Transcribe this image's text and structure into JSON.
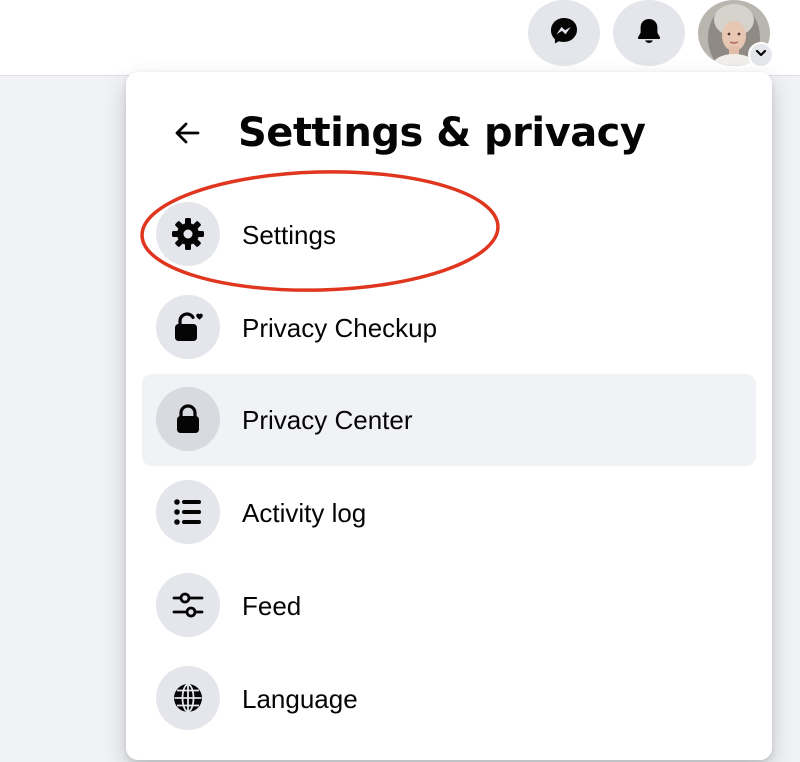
{
  "topbar": {
    "messenger_icon": "messenger-icon",
    "notifications_icon": "bell-icon",
    "account_chevron_icon": "chevron-down-icon"
  },
  "panel": {
    "title": "Settings & privacy",
    "back_icon": "arrow-left-icon",
    "items": [
      {
        "label": "Settings",
        "icon": "gear-icon",
        "highlighted": true
      },
      {
        "label": "Privacy Checkup",
        "icon": "lock-heart-icon"
      },
      {
        "label": "Privacy Center",
        "icon": "lock-icon",
        "active": true
      },
      {
        "label": "Activity log",
        "icon": "list-icon"
      },
      {
        "label": "Feed",
        "icon": "sliders-icon"
      },
      {
        "label": "Language",
        "icon": "globe-icon"
      }
    ]
  },
  "colors": {
    "icon_circle": "#e4e6eb",
    "active_row": "#f0f2f5",
    "highlight_ellipse": "#e0351f",
    "text": "#050505"
  }
}
